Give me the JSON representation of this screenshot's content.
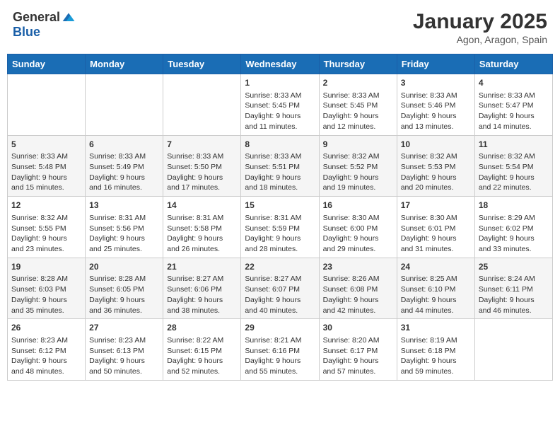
{
  "header": {
    "logo_general": "General",
    "logo_blue": "Blue",
    "month": "January 2025",
    "location": "Agon, Aragon, Spain"
  },
  "weekdays": [
    "Sunday",
    "Monday",
    "Tuesday",
    "Wednesday",
    "Thursday",
    "Friday",
    "Saturday"
  ],
  "weeks": [
    [
      {
        "day": "",
        "sunrise": "",
        "sunset": "",
        "daylight": ""
      },
      {
        "day": "",
        "sunrise": "",
        "sunset": "",
        "daylight": ""
      },
      {
        "day": "",
        "sunrise": "",
        "sunset": "",
        "daylight": ""
      },
      {
        "day": "1",
        "sunrise": "Sunrise: 8:33 AM",
        "sunset": "Sunset: 5:45 PM",
        "daylight": "Daylight: 9 hours and 11 minutes."
      },
      {
        "day": "2",
        "sunrise": "Sunrise: 8:33 AM",
        "sunset": "Sunset: 5:45 PM",
        "daylight": "Daylight: 9 hours and 12 minutes."
      },
      {
        "day": "3",
        "sunrise": "Sunrise: 8:33 AM",
        "sunset": "Sunset: 5:46 PM",
        "daylight": "Daylight: 9 hours and 13 minutes."
      },
      {
        "day": "4",
        "sunrise": "Sunrise: 8:33 AM",
        "sunset": "Sunset: 5:47 PM",
        "daylight": "Daylight: 9 hours and 14 minutes."
      }
    ],
    [
      {
        "day": "5",
        "sunrise": "Sunrise: 8:33 AM",
        "sunset": "Sunset: 5:48 PM",
        "daylight": "Daylight: 9 hours and 15 minutes."
      },
      {
        "day": "6",
        "sunrise": "Sunrise: 8:33 AM",
        "sunset": "Sunset: 5:49 PM",
        "daylight": "Daylight: 9 hours and 16 minutes."
      },
      {
        "day": "7",
        "sunrise": "Sunrise: 8:33 AM",
        "sunset": "Sunset: 5:50 PM",
        "daylight": "Daylight: 9 hours and 17 minutes."
      },
      {
        "day": "8",
        "sunrise": "Sunrise: 8:33 AM",
        "sunset": "Sunset: 5:51 PM",
        "daylight": "Daylight: 9 hours and 18 minutes."
      },
      {
        "day": "9",
        "sunrise": "Sunrise: 8:32 AM",
        "sunset": "Sunset: 5:52 PM",
        "daylight": "Daylight: 9 hours and 19 minutes."
      },
      {
        "day": "10",
        "sunrise": "Sunrise: 8:32 AM",
        "sunset": "Sunset: 5:53 PM",
        "daylight": "Daylight: 9 hours and 20 minutes."
      },
      {
        "day": "11",
        "sunrise": "Sunrise: 8:32 AM",
        "sunset": "Sunset: 5:54 PM",
        "daylight": "Daylight: 9 hours and 22 minutes."
      }
    ],
    [
      {
        "day": "12",
        "sunrise": "Sunrise: 8:32 AM",
        "sunset": "Sunset: 5:55 PM",
        "daylight": "Daylight: 9 hours and 23 minutes."
      },
      {
        "day": "13",
        "sunrise": "Sunrise: 8:31 AM",
        "sunset": "Sunset: 5:56 PM",
        "daylight": "Daylight: 9 hours and 25 minutes."
      },
      {
        "day": "14",
        "sunrise": "Sunrise: 8:31 AM",
        "sunset": "Sunset: 5:58 PM",
        "daylight": "Daylight: 9 hours and 26 minutes."
      },
      {
        "day": "15",
        "sunrise": "Sunrise: 8:31 AM",
        "sunset": "Sunset: 5:59 PM",
        "daylight": "Daylight: 9 hours and 28 minutes."
      },
      {
        "day": "16",
        "sunrise": "Sunrise: 8:30 AM",
        "sunset": "Sunset: 6:00 PM",
        "daylight": "Daylight: 9 hours and 29 minutes."
      },
      {
        "day": "17",
        "sunrise": "Sunrise: 8:30 AM",
        "sunset": "Sunset: 6:01 PM",
        "daylight": "Daylight: 9 hours and 31 minutes."
      },
      {
        "day": "18",
        "sunrise": "Sunrise: 8:29 AM",
        "sunset": "Sunset: 6:02 PM",
        "daylight": "Daylight: 9 hours and 33 minutes."
      }
    ],
    [
      {
        "day": "19",
        "sunrise": "Sunrise: 8:28 AM",
        "sunset": "Sunset: 6:03 PM",
        "daylight": "Daylight: 9 hours and 35 minutes."
      },
      {
        "day": "20",
        "sunrise": "Sunrise: 8:28 AM",
        "sunset": "Sunset: 6:05 PM",
        "daylight": "Daylight: 9 hours and 36 minutes."
      },
      {
        "day": "21",
        "sunrise": "Sunrise: 8:27 AM",
        "sunset": "Sunset: 6:06 PM",
        "daylight": "Daylight: 9 hours and 38 minutes."
      },
      {
        "day": "22",
        "sunrise": "Sunrise: 8:27 AM",
        "sunset": "Sunset: 6:07 PM",
        "daylight": "Daylight: 9 hours and 40 minutes."
      },
      {
        "day": "23",
        "sunrise": "Sunrise: 8:26 AM",
        "sunset": "Sunset: 6:08 PM",
        "daylight": "Daylight: 9 hours and 42 minutes."
      },
      {
        "day": "24",
        "sunrise": "Sunrise: 8:25 AM",
        "sunset": "Sunset: 6:10 PM",
        "daylight": "Daylight: 9 hours and 44 minutes."
      },
      {
        "day": "25",
        "sunrise": "Sunrise: 8:24 AM",
        "sunset": "Sunset: 6:11 PM",
        "daylight": "Daylight: 9 hours and 46 minutes."
      }
    ],
    [
      {
        "day": "26",
        "sunrise": "Sunrise: 8:23 AM",
        "sunset": "Sunset: 6:12 PM",
        "daylight": "Daylight: 9 hours and 48 minutes."
      },
      {
        "day": "27",
        "sunrise": "Sunrise: 8:23 AM",
        "sunset": "Sunset: 6:13 PM",
        "daylight": "Daylight: 9 hours and 50 minutes."
      },
      {
        "day": "28",
        "sunrise": "Sunrise: 8:22 AM",
        "sunset": "Sunset: 6:15 PM",
        "daylight": "Daylight: 9 hours and 52 minutes."
      },
      {
        "day": "29",
        "sunrise": "Sunrise: 8:21 AM",
        "sunset": "Sunset: 6:16 PM",
        "daylight": "Daylight: 9 hours and 55 minutes."
      },
      {
        "day": "30",
        "sunrise": "Sunrise: 8:20 AM",
        "sunset": "Sunset: 6:17 PM",
        "daylight": "Daylight: 9 hours and 57 minutes."
      },
      {
        "day": "31",
        "sunrise": "Sunrise: 8:19 AM",
        "sunset": "Sunset: 6:18 PM",
        "daylight": "Daylight: 9 hours and 59 minutes."
      },
      {
        "day": "",
        "sunrise": "",
        "sunset": "",
        "daylight": ""
      }
    ]
  ]
}
